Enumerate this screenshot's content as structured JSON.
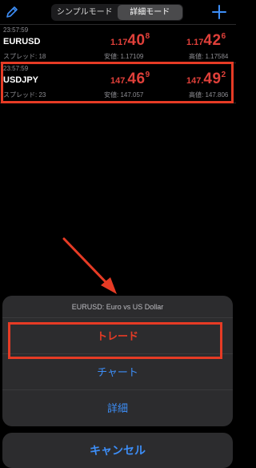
{
  "header": {
    "tabs": [
      {
        "label": "シンプルモード",
        "active": false
      },
      {
        "label": "詳細モード",
        "active": true
      }
    ],
    "edit_icon": "pencil-icon",
    "add_icon": "plus-icon"
  },
  "quotes": [
    {
      "time": "23:57:59",
      "symbol": "EURUSD",
      "spread": "スプレッド: 18",
      "bid": {
        "prefix": "1.17",
        "big": "40",
        "sup": "8"
      },
      "ask": {
        "prefix": "1.17",
        "big": "42",
        "sup": "6"
      },
      "low": "安値: 1.17109",
      "high": "高値: 1.17584"
    },
    {
      "time": "23:57:59",
      "symbol": "USDJPY",
      "spread": "スプレッド: 23",
      "bid": {
        "prefix": "147.",
        "big": "46",
        "sup": "9"
      },
      "ask": {
        "prefix": "147.",
        "big": "49",
        "sup": "2"
      },
      "low": "安値: 147.057",
      "high": "高値: 147.806"
    }
  ],
  "action_sheet": {
    "title": "EURUSD: Euro vs US Dollar",
    "trade": "トレード",
    "chart": "チャート",
    "details": "詳細",
    "cancel": "キャンセル"
  },
  "colors": {
    "price": "#e0403a",
    "accent": "#3d8ef7",
    "highlight": "#e63b25"
  }
}
